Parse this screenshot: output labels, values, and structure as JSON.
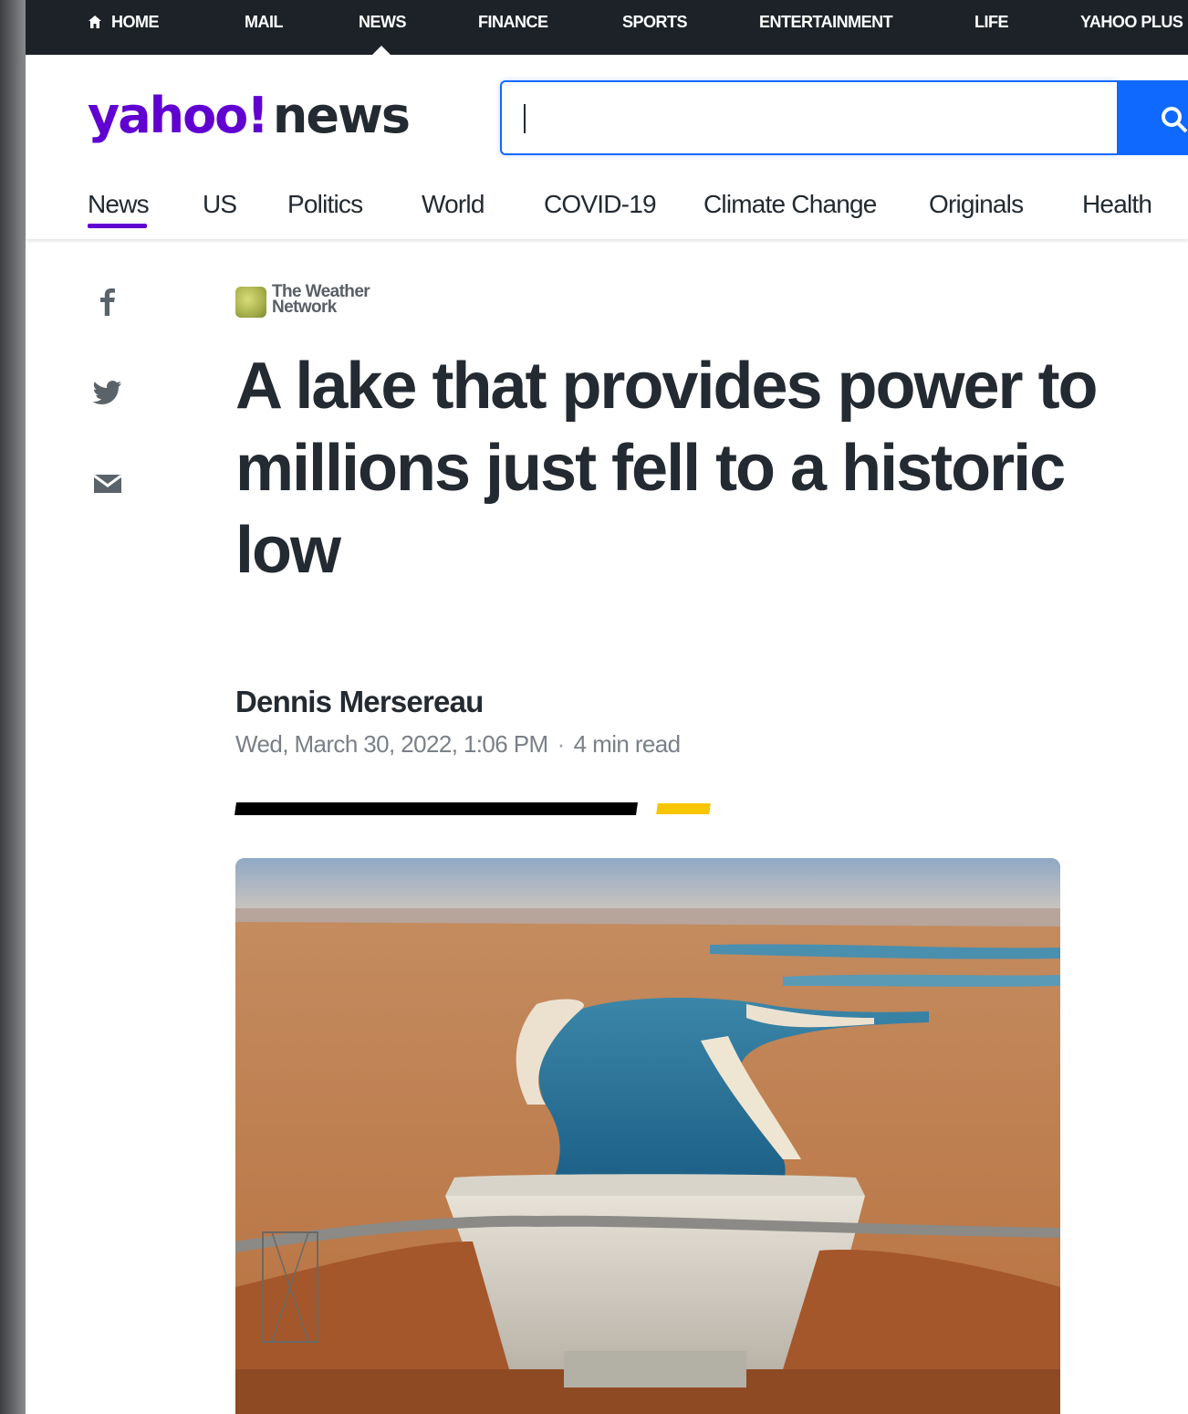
{
  "top_nav": {
    "items": [
      "HOME",
      "MAIL",
      "NEWS",
      "FINANCE",
      "SPORTS",
      "ENTERTAINMENT",
      "LIFE",
      "YAHOO PLUS"
    ],
    "active": "NEWS"
  },
  "brand": {
    "part1": "yahoo!",
    "part2": "news"
  },
  "search": {
    "value": "",
    "placeholder": ""
  },
  "sub_nav": {
    "items": [
      "News",
      "US",
      "Politics",
      "World",
      "COVID-19",
      "Climate Change",
      "Originals",
      "Health"
    ],
    "active": "News"
  },
  "share": [
    "facebook-icon",
    "twitter-icon",
    "email-icon"
  ],
  "article": {
    "provider": "The Weather Network",
    "headline": "A lake that provides power to millions just fell to a historic low",
    "author": "Dennis Mersereau",
    "date": "Wed, March 30, 2022, 1:06 PM",
    "separator": "·",
    "read_time": "4 min read"
  },
  "colors": {
    "brand_purple": "#6001d2",
    "search_blue": "#0f69ff",
    "top_bar": "#1d2228",
    "text": "#232a31",
    "meta_gray": "#7a8088",
    "accent_yellow": "#f7c600"
  }
}
